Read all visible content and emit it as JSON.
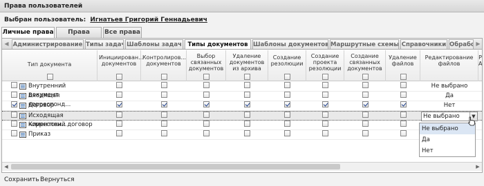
{
  "window": {
    "title": "Права пользователей"
  },
  "user": {
    "label": "Выбран пользователь:",
    "name": "Игнатьев Григорий Геннадьевич"
  },
  "main_tabs": [
    {
      "label": "Личные права",
      "active": true
    },
    {
      "label": "Права групп",
      "active": false
    },
    {
      "label": "Все права",
      "active": false
    }
  ],
  "sub_tabs": [
    {
      "label": "Администрирование",
      "active": false
    },
    {
      "label": "Типы задач",
      "active": false
    },
    {
      "label": "Шаблоны задач",
      "active": false
    },
    {
      "label": "Типы документов",
      "active": true
    },
    {
      "label": "Шаблоны документов",
      "active": false
    },
    {
      "label": "Маршрутные схемы",
      "active": false
    },
    {
      "label": "Справочники",
      "active": false
    },
    {
      "label": "Обрабо",
      "active": false
    }
  ],
  "columns": [
    {
      "key": "type",
      "label": "Тип документа"
    },
    {
      "key": "init",
      "label": "Инициирован... документов"
    },
    {
      "key": "ctrl",
      "label": "Контролиров... документов"
    },
    {
      "key": "linked",
      "label": "Выбор связанных документов"
    },
    {
      "key": "del_arch",
      "label": "Удаление документов из архива"
    },
    {
      "key": "res",
      "label": "Создание резолюции"
    },
    {
      "key": "proj",
      "label": "Создание проекта резолюции"
    },
    {
      "key": "create_linked",
      "label": "Создание связанных документов"
    },
    {
      "key": "del_files",
      "label": "Удаление файлов"
    },
    {
      "key": "edit_files",
      "label": "Редактирование файлов"
    },
    {
      "key": "more",
      "label": "Р А"
    }
  ],
  "rows": [
    {
      "name": "Внутренний документ",
      "checked": false,
      "flags": [
        false,
        false,
        false,
        false,
        false,
        false,
        false,
        false
      ],
      "edit": "Не выбрано",
      "selected": false
    },
    {
      "name": "Входящая корреспонд...",
      "checked": false,
      "flags": [
        false,
        false,
        false,
        false,
        false,
        false,
        false,
        false
      ],
      "edit": "Да",
      "selected": false
    },
    {
      "name": "Договор",
      "checked": true,
      "flags": [
        true,
        true,
        true,
        true,
        true,
        true,
        true,
        true
      ],
      "edit": "Нет",
      "selected": false
    },
    {
      "name": "Исходящая корреспон...",
      "checked": false,
      "flags": [
        false,
        false,
        false,
        false,
        false,
        false,
        false,
        false
      ],
      "edit": "Не выбрано",
      "selected": true
    },
    {
      "name": "Клиентский договор",
      "checked": false,
      "flags": [
        false,
        false,
        false,
        false,
        false,
        false,
        false,
        false
      ],
      "edit": "",
      "selected": false
    },
    {
      "name": "Приказ",
      "checked": false,
      "flags": [
        false,
        false,
        false,
        false,
        false,
        false,
        false,
        false
      ],
      "edit": "",
      "selected": false
    }
  ],
  "dropdown": {
    "options": [
      "Не выбрано",
      "Да",
      "Нет"
    ],
    "highlighted": 0
  },
  "footer": {
    "save": "Сохранить",
    "back": "Вернуться"
  }
}
